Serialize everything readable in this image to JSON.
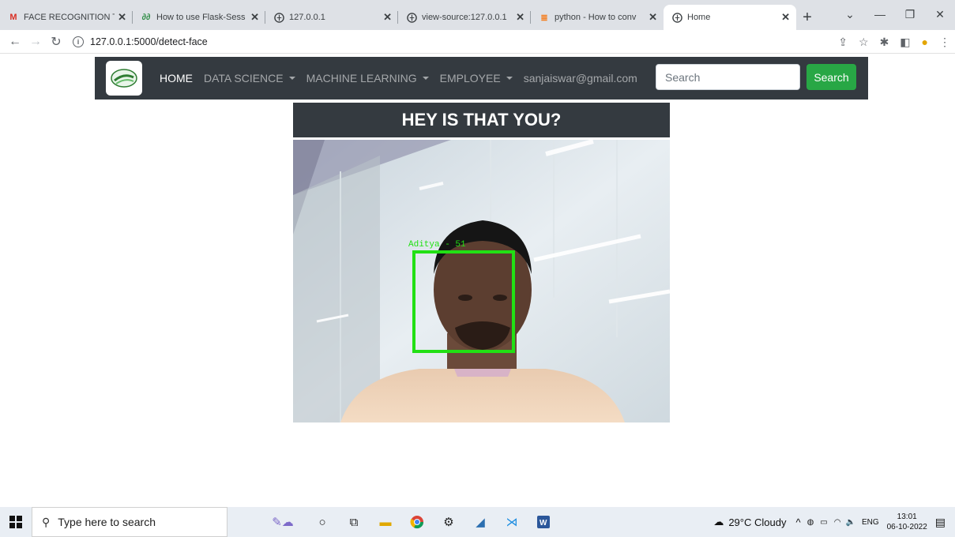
{
  "browser": {
    "tabs": [
      {
        "label": "FACE RECOGNITION T",
        "icon": "gmail-icon",
        "active": false
      },
      {
        "label": "How to use Flask-Sess",
        "icon": "geeksforgeeks-icon",
        "active": false
      },
      {
        "label": "127.0.0.1",
        "icon": "globe-icon",
        "active": false
      },
      {
        "label": "view-source:127.0.0.1",
        "icon": "globe-icon",
        "active": false
      },
      {
        "label": "python - How to conv",
        "icon": "stackoverflow-icon",
        "active": false
      },
      {
        "label": "Home",
        "icon": "globe-icon",
        "active": true
      }
    ],
    "url": "127.0.0.1:5000/detect-face"
  },
  "site": {
    "nav": {
      "home": "HOME",
      "data_science": "DATA SCIENCE",
      "machine_learning": "MACHINE LEARNING",
      "employee": "EMPLOYEE",
      "user_email": "sanjaiswar@gmail.com"
    },
    "search": {
      "placeholder": "Search",
      "button": "Search"
    },
    "heading": "HEY IS THAT YOU?",
    "detection_label": "Aditya - 51",
    "colors": {
      "navbar": "#343a40",
      "search_button": "#28a745",
      "detection_box": "#22e014"
    }
  },
  "taskbar": {
    "search_placeholder": "Type here to search",
    "weather": "29°C  Cloudy",
    "language": "ENG",
    "time": "13:01",
    "date": "06-10-2022"
  }
}
